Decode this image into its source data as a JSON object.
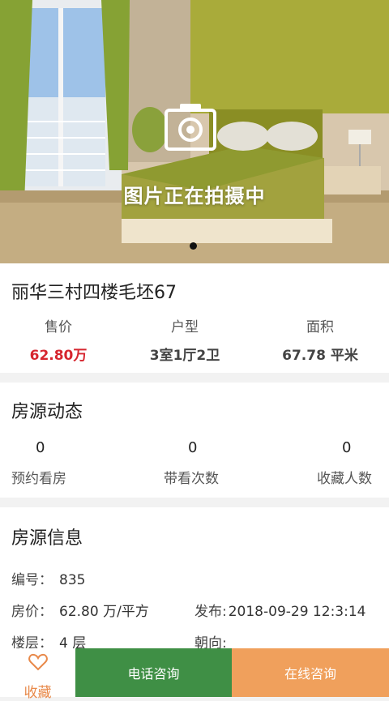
{
  "hero": {
    "caption": "图片正在拍摄中",
    "slide_count": 1,
    "active_slide": 1
  },
  "listing": {
    "title": "丽华三村四楼毛坯67",
    "stats": [
      {
        "label": "售价",
        "value": "62.80万"
      },
      {
        "label": "户型",
        "value": "3室1厅2卫"
      },
      {
        "label": "面积",
        "value": "67.78 平米"
      }
    ]
  },
  "dynamics": {
    "title": "房源动态",
    "items": [
      {
        "value": "0",
        "label": "预约看房"
      },
      {
        "value": "0",
        "label": "带看次数"
      },
      {
        "value": "0",
        "label": "收藏人数"
      }
    ]
  },
  "info": {
    "title": "房源信息",
    "rows": {
      "code_label": "编号：",
      "code_value": "835",
      "unit_price_label": "房价：",
      "unit_price_value": "62.80 万/平方",
      "publish_label": "发布:",
      "publish_value": "2018-09-29 12:3:14",
      "floor_label": "楼层：",
      "floor_value": "4 层",
      "orientation_label": "朝向:",
      "orientation_value": ""
    }
  },
  "bottom_bar": {
    "favorite_label": "收藏",
    "call_label": "电话咨询",
    "chat_label": "在线咨询",
    "colors": {
      "call": "#3f8f45",
      "chat": "#f0a05c",
      "favorite": "#e8894a"
    }
  },
  "colors": {
    "price": "#d6262f"
  }
}
